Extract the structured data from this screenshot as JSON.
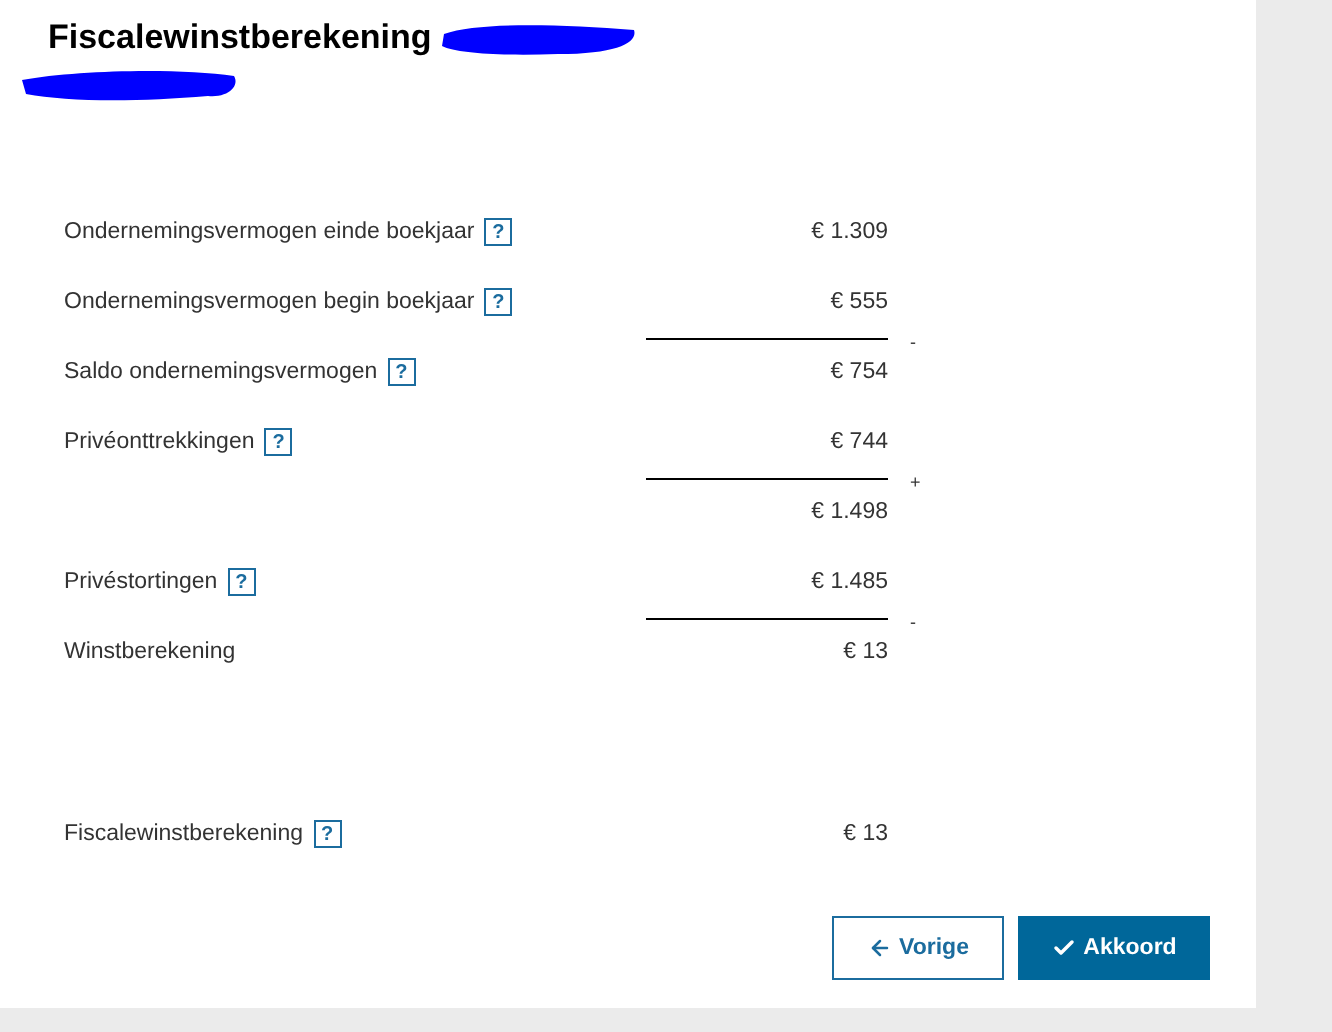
{
  "title": "Fiscalewinstberekening",
  "lines": [
    {
      "kind": "row",
      "label": "Ondernemingsvermogen einde boekjaar",
      "help": "?",
      "amount": "€ 1.309"
    },
    {
      "kind": "row",
      "label": "Ondernemingsvermogen begin boekjaar",
      "help": "?",
      "amount": "€ 555"
    },
    {
      "kind": "rule",
      "operator": "-"
    },
    {
      "kind": "row",
      "label": "Saldo ondernemingsvermogen",
      "help": "?",
      "amount": "€ 754"
    },
    {
      "kind": "row",
      "label": "Privéonttrekkingen",
      "help": "?",
      "amount": "€ 744"
    },
    {
      "kind": "rule",
      "operator": "+"
    },
    {
      "kind": "row",
      "amount": "€ 1.498"
    },
    {
      "kind": "row",
      "label": "Privéstortingen",
      "help": "?",
      "amount": "€ 1.485"
    },
    {
      "kind": "rule",
      "operator": "-"
    },
    {
      "kind": "row",
      "label": "Winstberekening",
      "amount": "€ 13"
    }
  ],
  "total": {
    "label": "Fiscalewinstberekening",
    "help": "?",
    "amount": "€ 13"
  },
  "buttons": {
    "back": "Vorige",
    "confirm": "Akkoord"
  }
}
